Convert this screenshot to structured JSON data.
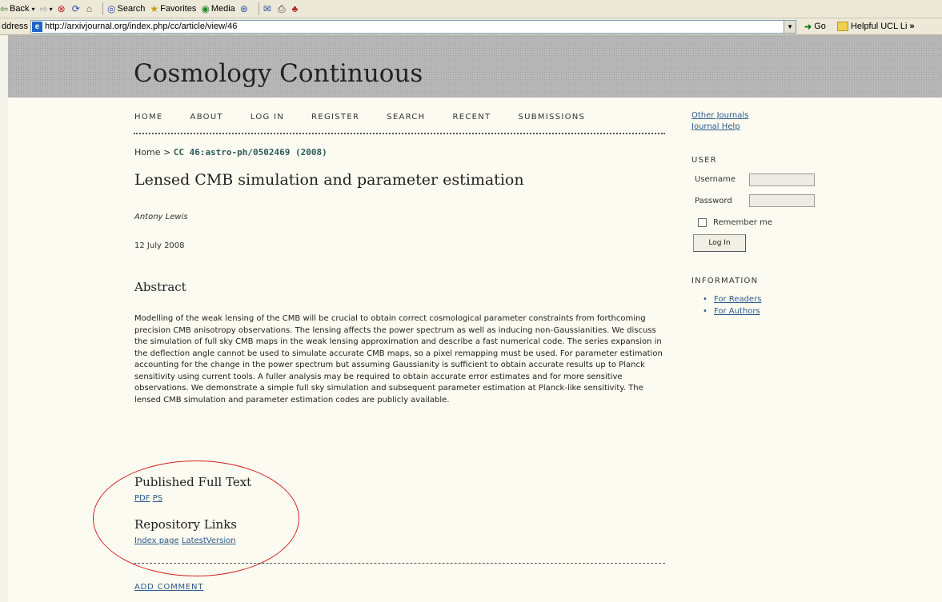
{
  "browser": {
    "toolbar": {
      "back": "Back",
      "search": "Search",
      "favorites": "Favorites",
      "media": "Media"
    },
    "address_label": "ddress",
    "url": "http://arxivjournal.org/index.php/cc/article/view/46",
    "go": "Go",
    "links": "Helpful UCL Li",
    "links_more": "»"
  },
  "site": {
    "title": "Cosmology Continuous"
  },
  "nav": [
    "HOME",
    "ABOUT",
    "LOG IN",
    "REGISTER",
    "SEARCH",
    "RECENT",
    "SUBMISSIONS"
  ],
  "breadcrumb": {
    "home": "Home",
    "sep": ">",
    "current": "CC 46:astro-ph/0502469 (2008)"
  },
  "article": {
    "title": "Lensed CMB simulation and parameter estimation",
    "author": "Antony Lewis",
    "date": "12 July 2008",
    "abstract_heading": "Abstract",
    "abstract": "Modelling of the weak lensing of the CMB will be crucial to obtain correct cosmological parameter constraints from forthcoming precision CMB anisotropy observations. The lensing affects the power spectrum as well as inducing non-Gaussianities. We discuss the simulation of full sky CMB maps in the weak lensing approximation and describe a fast numerical code. The series expansion in the deflection angle cannot be used to simulate accurate CMB maps, so a pixel remapping must be used. For parameter estimation accounting for the change in the power spectrum but assuming Gaussianity is sufficient to obtain accurate results up to Planck sensitivity using current tools. A fuller analysis may be required to obtain accurate error estimates and for more sensitive observations. We demonstrate a simple full sky simulation and subsequent parameter estimation at Planck-like sensitivity. The lensed CMB simulation and parameter estimation codes are publicly available.",
    "published_heading": "Published Full Text",
    "published_links": [
      "PDF",
      "PS"
    ],
    "repository_heading": "Repository Links",
    "repository_links": [
      "Index page",
      "LatestVersion"
    ],
    "add_comment": "ADD COMMENT"
  },
  "sidebar": {
    "links": [
      "Other Journals",
      "Journal Help"
    ],
    "user_heading": "USER",
    "username_label": "Username",
    "password_label": "Password",
    "remember_label": "Remember me",
    "login_button": "Log In",
    "info_heading": "INFORMATION",
    "info_links": [
      "For Readers",
      "For Authors"
    ]
  },
  "annotation_color": "#d42020"
}
